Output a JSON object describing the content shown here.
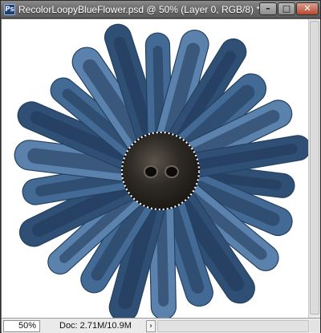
{
  "window": {
    "icon_letters": "Ps",
    "title": "RecolorLoopyBlueFlower.psd @ 50% (Layer 0, RGB/8) *",
    "minimize_glyph": "–",
    "maximize_glyph": "□",
    "close_glyph": "✕"
  },
  "canvas": {
    "subject": "blue felt loopy flower with dark button",
    "colors": {
      "felt": "#436a94",
      "felt_dark": "#2f4f75",
      "felt_light": "#5b82ad",
      "button": "#2a2621",
      "button_highlight": "#5a5449"
    }
  },
  "status": {
    "zoom": "50%",
    "doc_size": "Doc: 2.71M/10.9M",
    "arrow_glyph": "›"
  }
}
